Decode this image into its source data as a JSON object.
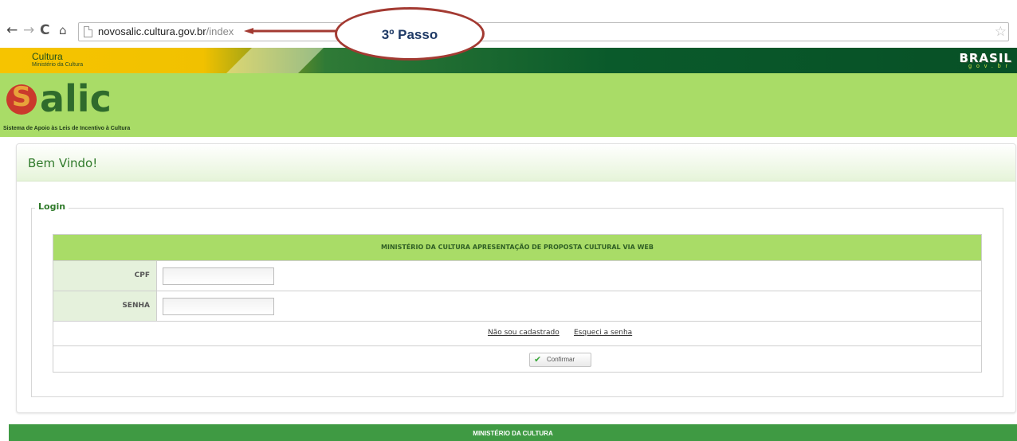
{
  "browser": {
    "url_host": "novosalic.cultura.gov.br",
    "url_path": "/index",
    "icons": [
      "back-arrow-icon",
      "forward-arrow-icon",
      "reload-icon",
      "home-icon",
      "page-icon",
      "bookmark-star-icon"
    ]
  },
  "annotation": {
    "callout_text": "3º Passo",
    "color": "#a33a32"
  },
  "gov_bar": {
    "cultura": "Cultura",
    "ministerio": "Ministério da Cultura",
    "brasil": "BRASIL",
    "brasil_sub": "gov.br"
  },
  "header": {
    "logo_letter": "S",
    "logo_word": "alic",
    "tagline": "Sistema de Apoio às Leis de Incentivo à Cultura"
  },
  "card": {
    "title": "Bem Vindo!"
  },
  "login": {
    "legend": "Login",
    "table_title": "MINISTÉRIO DA CULTURA APRESENTAÇÃO DE PROPOSTA CULTURAL VIA WEB",
    "cpf_label": "CPF",
    "cpf_value": "",
    "senha_label": "SENHA",
    "senha_value": "",
    "link_nao_cadastrado": "Não sou cadastrado",
    "link_esqueci": "Esqueci a senha",
    "confirm_label": "Confirmar"
  },
  "footer": {
    "text": "MINISTÉRIO DA CULTURA"
  },
  "colors": {
    "header_green": "#a9dc67",
    "title_green": "#2f7a2a",
    "footer_green": "#3f9a43"
  }
}
